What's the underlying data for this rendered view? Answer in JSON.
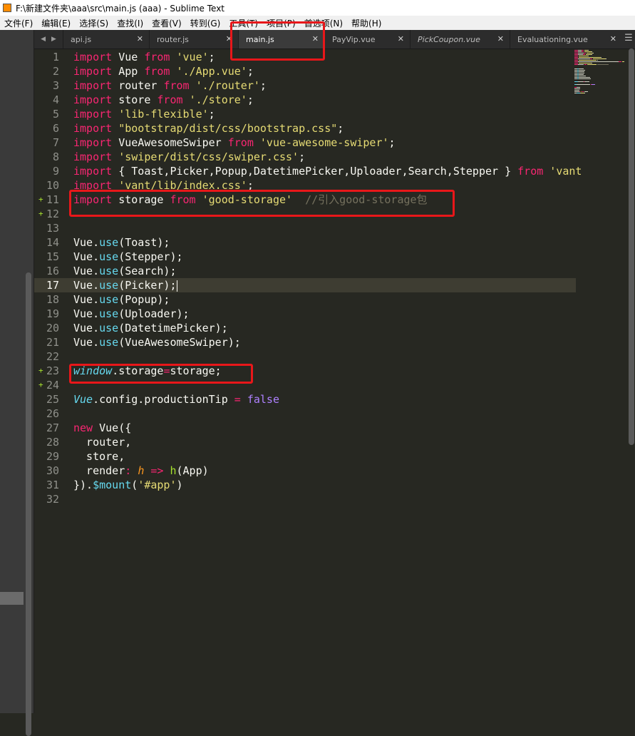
{
  "window": {
    "title": "F:\\新建文件夹\\aaa\\src\\main.js (aaa) - Sublime Text"
  },
  "menu": [
    "文件(F)",
    "编辑(E)",
    "选择(S)",
    "查找(I)",
    "查看(V)",
    "转到(G)",
    "工具(T)",
    "项目(P)",
    "首选项(N)",
    "帮助(H)"
  ],
  "tabs": [
    {
      "label": "api.js"
    },
    {
      "label": "router.js"
    },
    {
      "label": "main.js",
      "active": true
    },
    {
      "label": "PayVip.vue"
    },
    {
      "label": "PickCoupon.vue"
    },
    {
      "label": "Evaluationing.vue"
    }
  ],
  "editor": {
    "current_line": 17,
    "modified_lines": [
      11,
      12,
      23,
      24
    ],
    "lines": [
      [
        [
          "import",
          "kw"
        ],
        [
          " Vue ",
          ""
        ],
        [
          "from",
          "kw"
        ],
        [
          " ",
          ""
        ],
        [
          "'vue'",
          "st"
        ],
        [
          ";",
          ""
        ]
      ],
      [
        [
          "import",
          "kw"
        ],
        [
          " App ",
          ""
        ],
        [
          "from",
          "kw"
        ],
        [
          " ",
          ""
        ],
        [
          "'./App.vue'",
          "st"
        ],
        [
          ";",
          ""
        ]
      ],
      [
        [
          "import",
          "kw"
        ],
        [
          " router ",
          ""
        ],
        [
          "from",
          "kw"
        ],
        [
          " ",
          ""
        ],
        [
          "'./router'",
          "st"
        ],
        [
          ";",
          ""
        ]
      ],
      [
        [
          "import",
          "kw"
        ],
        [
          " store ",
          ""
        ],
        [
          "from",
          "kw"
        ],
        [
          " ",
          ""
        ],
        [
          "'./store'",
          "st"
        ],
        [
          ";",
          ""
        ]
      ],
      [
        [
          "import",
          "kw"
        ],
        [
          " ",
          ""
        ],
        [
          "'lib-flexible'",
          "st"
        ],
        [
          ";",
          ""
        ]
      ],
      [
        [
          "import",
          "kw"
        ],
        [
          " ",
          ""
        ],
        [
          "\"bootstrap/dist/css/bootstrap.css\"",
          "st"
        ],
        [
          ";",
          ""
        ]
      ],
      [
        [
          "import",
          "kw"
        ],
        [
          " VueAwesomeSwiper ",
          ""
        ],
        [
          "from",
          "kw"
        ],
        [
          " ",
          ""
        ],
        [
          "'vue-awesome-swiper'",
          "st"
        ],
        [
          ";",
          ""
        ]
      ],
      [
        [
          "import",
          "kw"
        ],
        [
          " ",
          ""
        ],
        [
          "'swiper/dist/css/swiper.css'",
          "st"
        ],
        [
          ";",
          ""
        ]
      ],
      [
        [
          "import",
          "kw"
        ],
        [
          " { Toast,Picker,Popup,DatetimePicker,Uploader,Search,Stepper } ",
          ""
        ],
        [
          "from",
          "kw"
        ],
        [
          " ",
          ""
        ],
        [
          "'vant",
          "st"
        ]
      ],
      [
        [
          "import",
          "kw"
        ],
        [
          " ",
          ""
        ],
        [
          "'vant/lib/index.css'",
          "st"
        ],
        [
          ";",
          ""
        ]
      ],
      [
        [
          "import",
          "kw"
        ],
        [
          " storage ",
          ""
        ],
        [
          "from",
          "kw"
        ],
        [
          " ",
          ""
        ],
        [
          "'good-storage'",
          "st"
        ],
        [
          "  ",
          ""
        ],
        [
          "//引入good-storage包",
          "cm"
        ]
      ],
      [],
      [],
      [
        [
          "Vue.",
          ""
        ],
        [
          "use",
          "fn"
        ],
        [
          "(Toast);",
          ""
        ]
      ],
      [
        [
          "Vue.",
          ""
        ],
        [
          "use",
          "fn"
        ],
        [
          "(Stepper);",
          ""
        ]
      ],
      [
        [
          "Vue.",
          ""
        ],
        [
          "use",
          "fn"
        ],
        [
          "(Search);",
          ""
        ]
      ],
      [
        [
          "Vue.",
          ""
        ],
        [
          "use",
          "fn"
        ],
        [
          "(Picker);",
          ""
        ]
      ],
      [
        [
          "Vue.",
          ""
        ],
        [
          "use",
          "fn"
        ],
        [
          "(Popup);",
          ""
        ]
      ],
      [
        [
          "Vue.",
          ""
        ],
        [
          "use",
          "fn"
        ],
        [
          "(Uploader);",
          ""
        ]
      ],
      [
        [
          "Vue.",
          ""
        ],
        [
          "use",
          "fn"
        ],
        [
          "(DatetimePicker);",
          ""
        ]
      ],
      [
        [
          "Vue.",
          ""
        ],
        [
          "use",
          "fn"
        ],
        [
          "(VueAwesomeSwiper);",
          ""
        ]
      ],
      [],
      [
        [
          "window",
          "it"
        ],
        [
          ".storage",
          ""
        ],
        [
          "=",
          "kw"
        ],
        [
          "storage;",
          ""
        ]
      ],
      [],
      [
        [
          "Vue",
          "it"
        ],
        [
          ".config.productionTip ",
          ""
        ],
        [
          "=",
          "kw"
        ],
        [
          " ",
          ""
        ],
        [
          "false",
          "bl"
        ]
      ],
      [],
      [
        [
          "new",
          "kw"
        ],
        [
          " Vue({",
          ""
        ]
      ],
      [
        [
          "  router,",
          ""
        ]
      ],
      [
        [
          "  store,",
          ""
        ]
      ],
      [
        [
          "  render",
          ""
        ],
        [
          ":",
          "kw"
        ],
        [
          " ",
          ""
        ],
        [
          "h",
          "pm"
        ],
        [
          " ",
          ""
        ],
        [
          "=>",
          "ar"
        ],
        [
          " ",
          ""
        ],
        [
          "h",
          "gr"
        ],
        [
          "(App)",
          ""
        ]
      ],
      [
        [
          "}).",
          ""
        ],
        [
          "$mount",
          "fn"
        ],
        [
          "(",
          ""
        ],
        [
          "'#app'",
          "st"
        ],
        [
          ")",
          ""
        ]
      ],
      []
    ]
  },
  "colors": {
    "highlight_box": "#e8171a",
    "editor_bg": "#272822"
  }
}
